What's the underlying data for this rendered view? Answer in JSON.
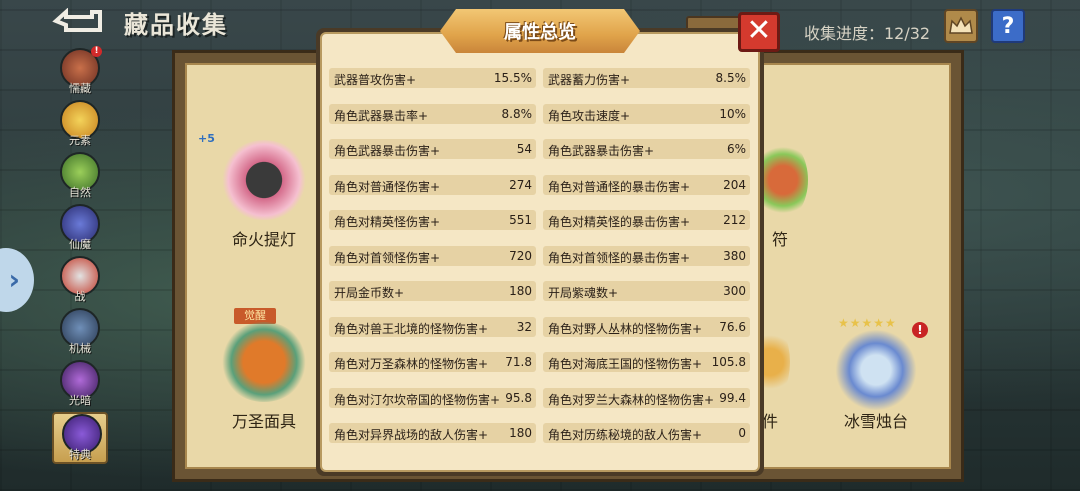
{
  "header": {
    "title": "藏品收集",
    "progress_label": "收集进度：12/32",
    "back_icon": "back-arrow-icon",
    "trophy_icon": "crown-icon",
    "help_text": "?"
  },
  "sidebar": {
    "items": [
      {
        "label": "懦藏",
        "icon": "relic-icon",
        "badge": "!"
      },
      {
        "label": "元素",
        "icon": "element-icon"
      },
      {
        "label": "自然",
        "icon": "nature-icon"
      },
      {
        "label": "仙魔",
        "icon": "demon-icon"
      },
      {
        "label": "战",
        "icon": "battle-icon"
      },
      {
        "label": "机械",
        "icon": "mech-icon"
      },
      {
        "label": "光暗",
        "icon": "light-dark-icon"
      },
      {
        "label": "特典",
        "icon": "special-icon",
        "active": true
      }
    ],
    "expand_glyph": "›"
  },
  "collection": {
    "items": [
      {
        "name": "命火提灯",
        "level_up": "+5"
      },
      {
        "name": "符"
      },
      {
        "name": "万圣面具",
        "tag": "觉醒"
      },
      {
        "name": "件"
      },
      {
        "name": "冰雪烛台",
        "stars": "★★★★★",
        "badge": "!"
      }
    ]
  },
  "popup": {
    "title": "属性总览",
    "close_glyph": "✕",
    "stats": [
      {
        "label": "武器普攻伤害+",
        "value": "15.5%"
      },
      {
        "label": "武器蓄力伤害+",
        "value": "8.5%"
      },
      {
        "label": "角色武器暴击率+",
        "value": "8.8%"
      },
      {
        "label": "角色攻击速度+",
        "value": "10%"
      },
      {
        "label": "角色武器暴击伤害+",
        "value": "54"
      },
      {
        "label": "角色武器暴击伤害+",
        "value": "6%"
      },
      {
        "label": "角色对普通怪伤害+",
        "value": "274"
      },
      {
        "label": "角色对普通怪的暴击伤害+",
        "value": "204"
      },
      {
        "label": "角色对精英怪伤害+",
        "value": "551"
      },
      {
        "label": "角色对精英怪的暴击伤害+",
        "value": "212"
      },
      {
        "label": "角色对首领怪伤害+",
        "value": "720"
      },
      {
        "label": "角色对首领怪的暴击伤害+",
        "value": "380"
      },
      {
        "label": "开局金币数+",
        "value": "180"
      },
      {
        "label": "开局紫魂数+",
        "value": "300"
      },
      {
        "label": "角色对兽王北境的怪物伤害+",
        "value": "32"
      },
      {
        "label": "角色对野人丛林的怪物伤害+",
        "value": "76.6"
      },
      {
        "label": "角色对万圣森林的怪物伤害+",
        "value": "71.8"
      },
      {
        "label": "角色对海底王国的怪物伤害+",
        "value": "105.8"
      },
      {
        "label": "角色对汀尔坎帝国的怪物伤害+",
        "value": "95.8"
      },
      {
        "label": "角色对罗兰大森林的怪物伤害+",
        "value": "99.4"
      },
      {
        "label": "角色对异界战场的敌人伤害+",
        "value": "180"
      },
      {
        "label": "角色对历练秘境的敌人伤害+",
        "value": "0"
      }
    ]
  }
}
